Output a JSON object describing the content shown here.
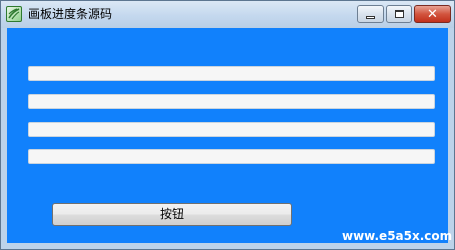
{
  "window": {
    "title": "画板进度条源码",
    "icon": "app-icon",
    "controls": {
      "minimize_icon": "minimize-icon",
      "maximize_icon": "maximize-icon",
      "close_glyph": "✕"
    }
  },
  "colors": {
    "client_background": "#1181fc",
    "progress_track": "#f6f6f6",
    "progress_fill": "#06b025"
  },
  "progress_bars": [
    {
      "value": 0
    },
    {
      "value": 0
    },
    {
      "value": 0
    },
    {
      "value": 0
    }
  ],
  "button": {
    "label": "按钮"
  },
  "watermark": {
    "faint_text": "",
    "site": "www.e5a5x.com"
  }
}
